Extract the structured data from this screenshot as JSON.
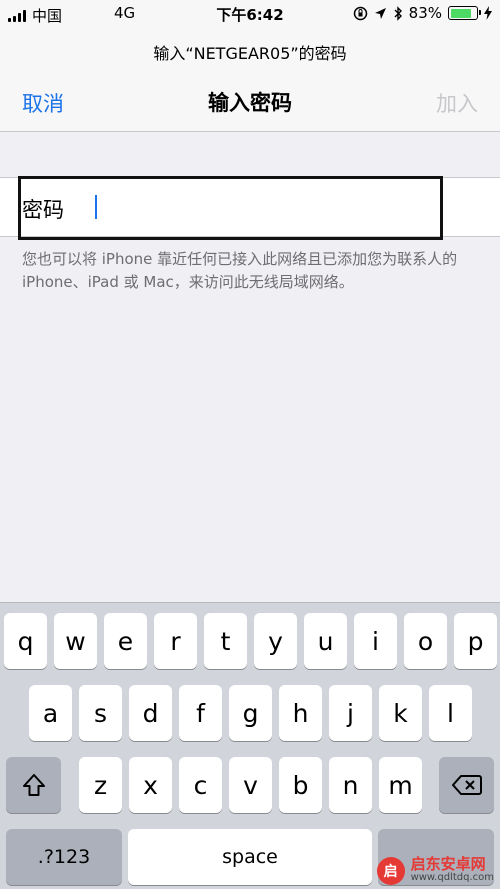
{
  "status_bar": {
    "carrier": "中国",
    "network": "4G",
    "time": "下午6:42",
    "battery": "83%",
    "battery_level": 0.83,
    "battery_color": "#4cd964"
  },
  "nav": {
    "prompt": "输入“NETGEAR05”的密码",
    "cancel": "取消",
    "title": "输入密码",
    "join": "加入"
  },
  "password": {
    "label": "密码",
    "value": "",
    "placeholder": ""
  },
  "hint": "您也可以将 iPhone 靠近任何已接入此网络且已添加您为联系人的 iPhone、iPad 或 Mac，来访问此无线局域网络。",
  "keyboard": {
    "row1": [
      "q",
      "w",
      "e",
      "r",
      "t",
      "y",
      "u",
      "i",
      "o",
      "p"
    ],
    "row2": [
      "a",
      "s",
      "d",
      "f",
      "g",
      "h",
      "j",
      "k",
      "l"
    ],
    "row3": [
      "z",
      "x",
      "c",
      "v",
      "b",
      "n",
      "m"
    ],
    "numbers": ".?123",
    "space": "space"
  },
  "watermark": {
    "name": "启东安卓网",
    "url": "www.qdltdq.com"
  },
  "colors": {
    "accent": "#1a73e8",
    "disabled": "#c7c7cc"
  }
}
